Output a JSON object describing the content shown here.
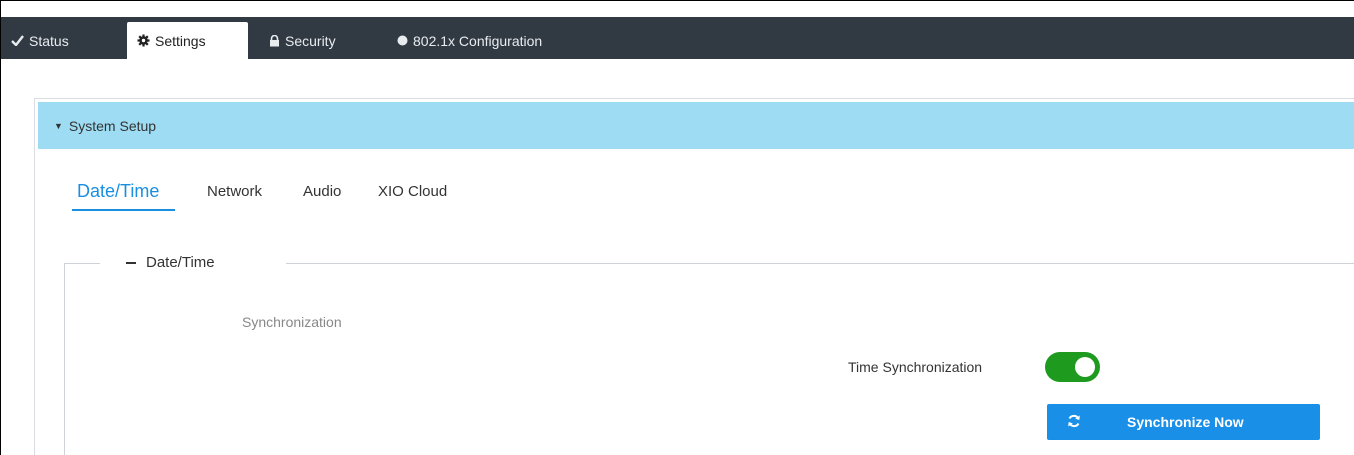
{
  "topnav": {
    "tabs": [
      {
        "label": "Status",
        "icon": "check-icon",
        "active": false
      },
      {
        "label": "Settings",
        "icon": "gear-icon",
        "active": true
      },
      {
        "label": "Security",
        "icon": "lock-icon",
        "active": false
      },
      {
        "label": "802.1x Configuration",
        "icon": "circle-icon",
        "active": false
      }
    ]
  },
  "section": {
    "title": "System Setup",
    "expanded": true
  },
  "subtabs": [
    {
      "label": "Date/Time",
      "active": true
    },
    {
      "label": "Network",
      "active": false
    },
    {
      "label": "Audio",
      "active": false
    },
    {
      "label": "XIO Cloud",
      "active": false
    }
  ],
  "datetime": {
    "legend": "Date/Time",
    "synchronization_heading": "Synchronization",
    "time_sync_label": "Time Synchronization",
    "time_sync_enabled": true,
    "sync_button_label": "Synchronize Now"
  },
  "colors": {
    "topnav_bg": "#313a43",
    "section_header_bg": "#9edcf3",
    "accent_blue": "#1a8fe0",
    "toggle_on": "#1e9a1e",
    "button_blue": "#1a8fe8"
  }
}
